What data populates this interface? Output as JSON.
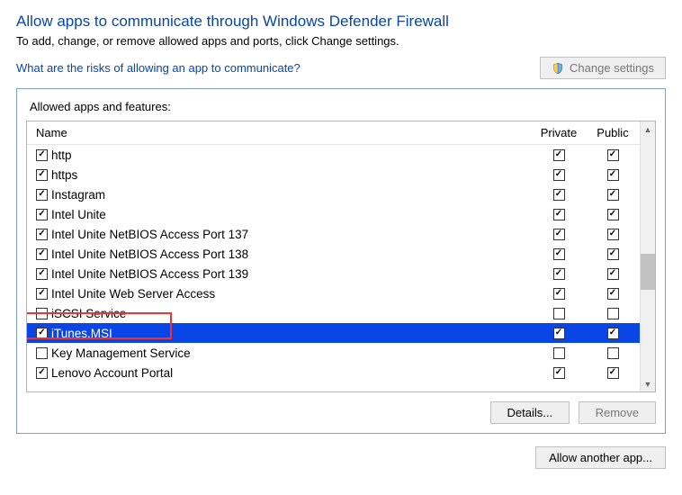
{
  "title": "Allow apps to communicate through Windows Defender Firewall",
  "desc": "To add, change, or remove allowed apps and ports, click Change settings.",
  "risk_link": "What are the risks of allowing an app to communicate?",
  "change_settings_label": "Change settings",
  "group_label": "Allowed apps and features:",
  "headers": {
    "name": "Name",
    "private": "Private",
    "public": "Public"
  },
  "rows": [
    {
      "name": "http",
      "name_on": true,
      "private": true,
      "public": true,
      "selected": false
    },
    {
      "name": "https",
      "name_on": true,
      "private": true,
      "public": true,
      "selected": false
    },
    {
      "name": "Instagram",
      "name_on": true,
      "private": true,
      "public": true,
      "selected": false
    },
    {
      "name": "Intel Unite",
      "name_on": true,
      "private": true,
      "public": true,
      "selected": false
    },
    {
      "name": "Intel Unite NetBIOS Access Port 137",
      "name_on": true,
      "private": true,
      "public": true,
      "selected": false
    },
    {
      "name": "Intel Unite NetBIOS Access Port 138",
      "name_on": true,
      "private": true,
      "public": true,
      "selected": false
    },
    {
      "name": "Intel Unite NetBIOS Access Port 139",
      "name_on": true,
      "private": true,
      "public": true,
      "selected": false
    },
    {
      "name": "Intel Unite Web Server Access",
      "name_on": true,
      "private": true,
      "public": true,
      "selected": false
    },
    {
      "name": "iSCSI Service",
      "name_on": false,
      "private": false,
      "public": false,
      "selected": false
    },
    {
      "name": "iTunes.MSI",
      "name_on": true,
      "private": true,
      "public": true,
      "selected": true,
      "annotated": true
    },
    {
      "name": "Key Management Service",
      "name_on": false,
      "private": false,
      "public": false,
      "selected": false
    },
    {
      "name": "Lenovo Account Portal",
      "name_on": true,
      "private": true,
      "public": true,
      "selected": false
    }
  ],
  "details_label": "Details...",
  "remove_label": "Remove",
  "allow_another_label": "Allow another app..."
}
